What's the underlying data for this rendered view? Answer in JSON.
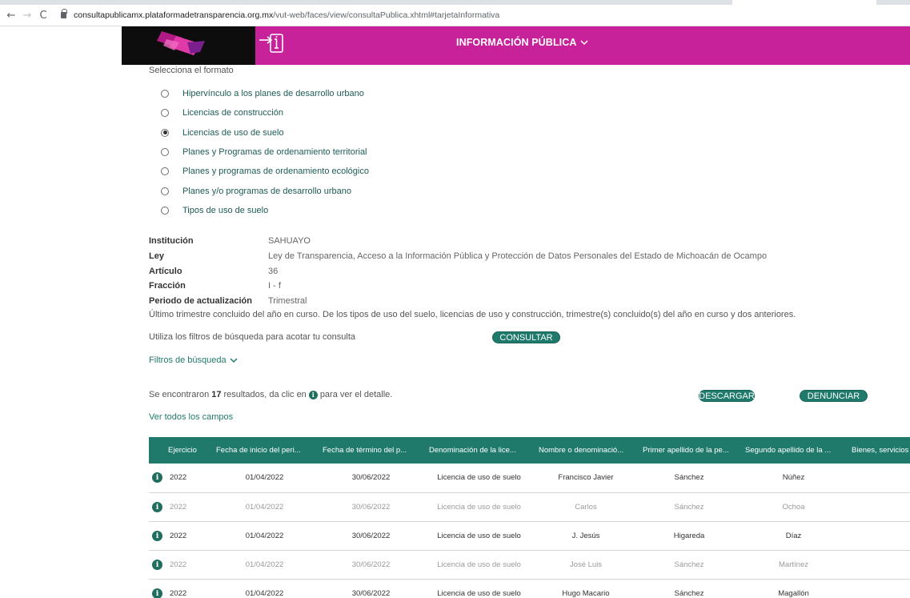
{
  "browser": {
    "back_icon": "←",
    "forward_icon": "→",
    "reload_icon": "C",
    "url_host": "consultapublicamx.plataformadetransparencia.org.mx",
    "url_rest": "/vut-web/faces/view/consultaPublica.xhtml#tarjetaInformativa"
  },
  "header": {
    "title": "INFORMACIÓN PÚBLICA",
    "brand_color": "#c8229a"
  },
  "formats": {
    "title": "Selecciona el formato",
    "options": [
      {
        "label": "Hipervínculo a los planes de desarrollo urbano",
        "checked": false
      },
      {
        "label": "Licencias de construcción",
        "checked": false
      },
      {
        "label": "Licencias de uso de suelo",
        "checked": true
      },
      {
        "label": "Planes y Programas de ordenamiento territorial",
        "checked": false
      },
      {
        "label": "Planes y programas de ordenamiento ecológico",
        "checked": false
      },
      {
        "label": "Planes y/o programas de desarrollo urbano",
        "checked": false
      },
      {
        "label": "Tipos de uso de suelo",
        "checked": false
      }
    ]
  },
  "info": {
    "rows": [
      {
        "key": "Institución",
        "value": "SAHUAYO"
      },
      {
        "key": "Ley",
        "value": "Ley de Transparencia, Acceso a la Información Pública y Protección de Datos Personales del Estado de Michoacán de Ocampo"
      },
      {
        "key": "Artículo",
        "value": "36"
      },
      {
        "key": "Fracción",
        "value": "I - f"
      },
      {
        "key": "Periodo de actualización",
        "value": "Trimestral"
      }
    ],
    "note": "Último trimestre concluido del año en curso. De los tipos de uso del suelo, licencias de uso y construcción, trimestre(s) concluido(s) del año en curso y dos anteriores."
  },
  "search": {
    "hint": "Utiliza los filtros de búsqueda para acotar tu consulta",
    "consultar_label": "CONSULTAR",
    "filters_label": "Filtros de búsqueda"
  },
  "results": {
    "prefix": "Se encontraron",
    "count": "17",
    "mid": "resultados, da clic en",
    "suffix": "para ver el detalle.",
    "descargar_label": "DESCARGAR",
    "denunciar_label": "DENUNCIAR",
    "ver_todos_label": "Ver todos los campos"
  },
  "table": {
    "accent_color": "#1f7a6c",
    "columns": [
      "",
      "Ejercicio",
      "Fecha de inicio del peri...",
      "Fecha de término del p...",
      "Denominación de la lice...",
      "Nombre o denominació...",
      "Primer apellido de la pe...",
      "Segundo apellido de la ...",
      "Bienes, servicios"
    ],
    "rows": [
      {
        "ejercicio": "2022",
        "inicio": "01/04/2022",
        "termino": "30/06/2022",
        "denominacion": "Licencia de uso de suelo",
        "nombre": "Francisco Javier",
        "apellido1": "Sánchez",
        "apellido2": "Núñez",
        "muted": false
      },
      {
        "ejercicio": "2022",
        "inicio": "01/04/2022",
        "termino": "30/06/2022",
        "denominacion": "Licencia de uso de suelo",
        "nombre": "Carlos",
        "apellido1": "Sánchez",
        "apellido2": "Ochoa",
        "muted": true
      },
      {
        "ejercicio": "2022",
        "inicio": "01/04/2022",
        "termino": "30/06/2022",
        "denominacion": "Licencia de uso de suelo",
        "nombre": "J. Jesús",
        "apellido1": "Higareda",
        "apellido2": "Díaz",
        "muted": false
      },
      {
        "ejercicio": "2022",
        "inicio": "01/04/2022",
        "termino": "30/06/2022",
        "denominacion": "Licencia de uso de suelo",
        "nombre": "José Luis",
        "apellido1": "Sánchez",
        "apellido2": "Martínez",
        "muted": true
      },
      {
        "ejercicio": "2022",
        "inicio": "01/04/2022",
        "termino": "30/06/2022",
        "denominacion": "Licencia de uso de suelo",
        "nombre": "Hugo Macario",
        "apellido1": "Sánchez",
        "apellido2": "Magallón",
        "muted": false
      }
    ]
  }
}
